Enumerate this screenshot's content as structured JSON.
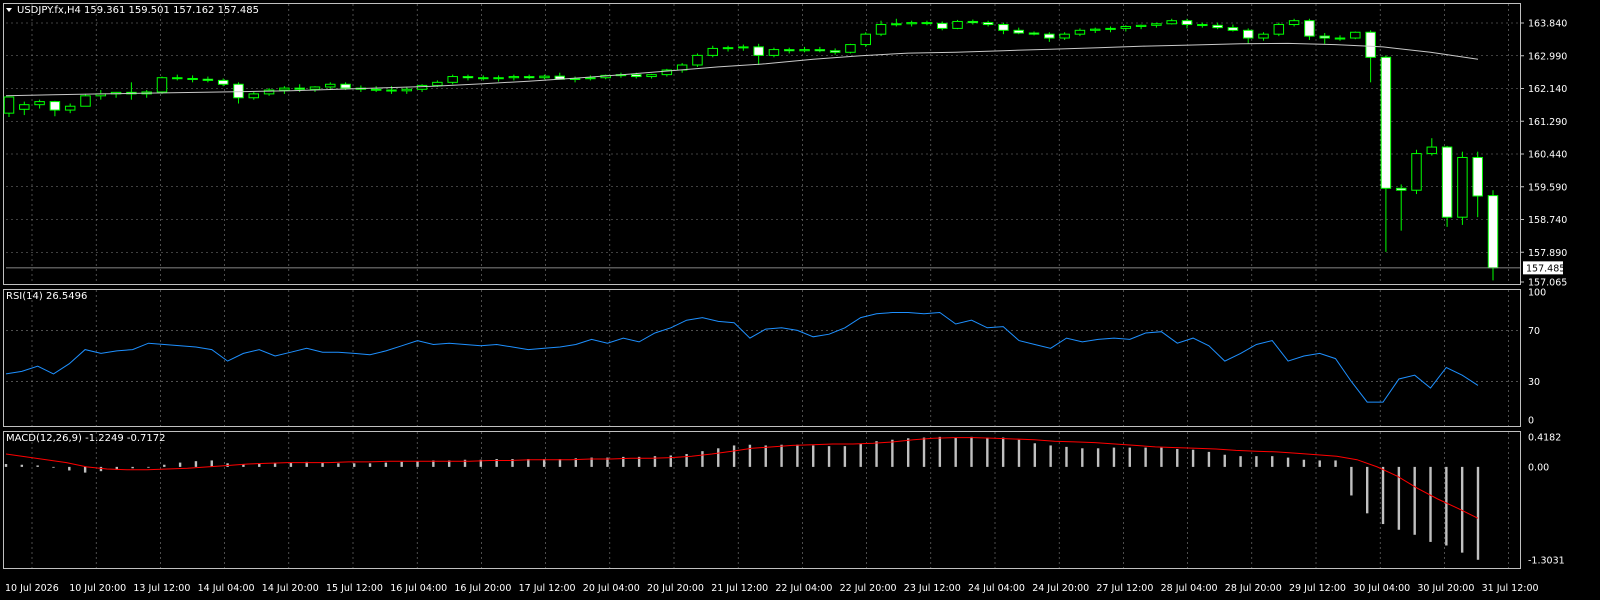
{
  "window": {
    "symbol_header": "USDJPY.fx,H4",
    "ohlc_header": "159.361 159.501 157.162 157.485"
  },
  "colors": {
    "background": "#000000",
    "grid": "#808080",
    "bull_body": "#000000",
    "bear_body": "#ffffff",
    "candle_wick": "#00ff00",
    "ma_line": "#c8c8c8",
    "rsi_line": "#1e90ff",
    "macd_hist": "#c0c0c0",
    "macd_signal": "#ff0000",
    "text": "#ffffff"
  },
  "chart_data": [
    {
      "type": "candlestick",
      "panel": "price",
      "title": "USDJPY.fx,H4",
      "ylim": [
        157.065,
        164.6
      ],
      "y_ticks": [
        "163.840",
        "162.990",
        "162.140",
        "161.290",
        "160.440",
        "159.590",
        "158.740",
        "157.890",
        "157.065"
      ],
      "last_price_label": "157.485",
      "last_price": 157.485,
      "x_tick_labels": [
        "10 Jul 2026",
        "10 Jul 20:00",
        "13 Jul 12:00",
        "14 Jul 04:00",
        "14 Jul 20:00",
        "15 Jul 12:00",
        "16 Jul 04:00",
        "16 Jul 20:00",
        "17 Jul 12:00",
        "20 Jul 04:00",
        "20 Jul 20:00",
        "21 Jul 12:00",
        "22 Jul 04:00",
        "22 Jul 20:00",
        "23 Jul 12:00",
        "24 Jul 04:00",
        "24 Jul 20:00",
        "27 Jul 12:00",
        "28 Jul 04:00",
        "28 Jul 20:00",
        "29 Jul 12:00",
        "30 Jul 04:00",
        "30 Jul 20:00",
        "31 Jul 12:00"
      ],
      "ohlc": [
        [
          161.5,
          161.7,
          161.4,
          161.92
        ],
        [
          161.6,
          161.8,
          161.45,
          161.72
        ],
        [
          161.72,
          161.85,
          161.62,
          161.8
        ],
        [
          161.8,
          161.82,
          161.42,
          161.58
        ],
        [
          161.58,
          161.75,
          161.5,
          161.68
        ],
        [
          161.68,
          162.0,
          161.68,
          161.95
        ],
        [
          161.95,
          162.1,
          161.85,
          162.0
        ],
        [
          162.0,
          162.05,
          161.9,
          162.04
        ],
        [
          162.04,
          162.3,
          161.85,
          162.0
        ],
        [
          162.0,
          162.1,
          161.9,
          162.05
        ],
        [
          162.05,
          162.45,
          162.0,
          162.42
        ],
        [
          162.42,
          162.5,
          162.35,
          162.4
        ],
        [
          162.4,
          162.48,
          162.3,
          162.38
        ],
        [
          162.38,
          162.45,
          162.3,
          162.35
        ],
        [
          162.35,
          162.4,
          162.2,
          162.25
        ],
        [
          162.25,
          162.3,
          161.75,
          161.9
        ],
        [
          161.9,
          162.05,
          161.85,
          162.0
        ],
        [
          162.0,
          162.15,
          161.95,
          162.1
        ],
        [
          162.1,
          162.2,
          162.0,
          162.15
        ],
        [
          162.15,
          162.25,
          162.05,
          162.12
        ],
        [
          162.12,
          162.2,
          162.05,
          162.18
        ],
        [
          162.18,
          162.3,
          162.1,
          162.25
        ],
        [
          162.25,
          162.3,
          162.1,
          162.15
        ],
        [
          162.15,
          162.22,
          162.05,
          162.12
        ],
        [
          162.12,
          162.2,
          162.05,
          162.1
        ],
        [
          162.1,
          162.2,
          162.0,
          162.08
        ],
        [
          162.08,
          162.18,
          162.0,
          162.12
        ],
        [
          162.12,
          162.25,
          162.05,
          162.22
        ],
        [
          162.22,
          162.35,
          162.18,
          162.3
        ],
        [
          162.3,
          162.5,
          162.25,
          162.45
        ],
        [
          162.45,
          162.5,
          162.35,
          162.42
        ],
        [
          162.42,
          162.48,
          162.35,
          162.4
        ],
        [
          162.4,
          162.48,
          162.32,
          162.42
        ],
        [
          162.42,
          162.5,
          162.35,
          162.45
        ],
        [
          162.45,
          162.5,
          162.38,
          162.42
        ],
        [
          162.42,
          162.5,
          162.38,
          162.46
        ],
        [
          162.46,
          162.55,
          162.4,
          162.38
        ],
        [
          162.38,
          162.45,
          162.3,
          162.4
        ],
        [
          162.4,
          162.48,
          162.35,
          162.42
        ],
        [
          162.42,
          162.5,
          162.38,
          162.48
        ],
        [
          162.48,
          162.55,
          162.42,
          162.5
        ],
        [
          162.5,
          162.55,
          162.4,
          162.45
        ],
        [
          162.45,
          162.52,
          162.4,
          162.5
        ],
        [
          162.5,
          162.65,
          162.45,
          162.62
        ],
        [
          162.62,
          162.8,
          162.55,
          162.75
        ],
        [
          162.75,
          163.05,
          162.7,
          163.0
        ],
        [
          163.0,
          163.25,
          162.95,
          163.18
        ],
        [
          163.18,
          163.25,
          163.1,
          163.2
        ],
        [
          163.2,
          163.28,
          163.12,
          163.22
        ],
        [
          163.22,
          163.3,
          162.75,
          163.0
        ],
        [
          163.0,
          163.2,
          162.95,
          163.15
        ],
        [
          163.15,
          163.2,
          163.05,
          163.12
        ],
        [
          163.12,
          163.22,
          163.08,
          163.15
        ],
        [
          163.15,
          163.22,
          163.08,
          163.12
        ],
        [
          163.12,
          163.18,
          163.02,
          163.08
        ],
        [
          163.08,
          163.3,
          163.05,
          163.28
        ],
        [
          163.28,
          163.6,
          163.22,
          163.55
        ],
        [
          163.55,
          163.9,
          163.5,
          163.8
        ],
        [
          163.8,
          163.95,
          163.75,
          163.82
        ],
        [
          163.82,
          163.9,
          163.75,
          163.85
        ],
        [
          163.85,
          163.9,
          163.78,
          163.83
        ],
        [
          163.83,
          163.88,
          163.65,
          163.7
        ],
        [
          163.7,
          163.92,
          163.68,
          163.88
        ],
        [
          163.88,
          163.93,
          163.8,
          163.85
        ],
        [
          163.85,
          163.9,
          163.75,
          163.8
        ],
        [
          163.8,
          163.85,
          163.55,
          163.65
        ],
        [
          163.65,
          163.72,
          163.55,
          163.58
        ],
        [
          163.58,
          163.62,
          163.52,
          163.55
        ],
        [
          163.55,
          163.6,
          163.35,
          163.45
        ],
        [
          163.45,
          163.6,
          163.4,
          163.55
        ],
        [
          163.55,
          163.7,
          163.5,
          163.65
        ],
        [
          163.65,
          163.72,
          163.58,
          163.68
        ],
        [
          163.68,
          163.75,
          163.6,
          163.7
        ],
        [
          163.7,
          163.78,
          163.62,
          163.75
        ],
        [
          163.75,
          163.8,
          163.68,
          163.78
        ],
        [
          163.78,
          163.85,
          163.72,
          163.82
        ],
        [
          163.82,
          163.95,
          163.8,
          163.9
        ],
        [
          163.9,
          163.95,
          163.7,
          163.8
        ],
        [
          163.8,
          163.85,
          163.72,
          163.78
        ],
        [
          163.78,
          163.85,
          163.68,
          163.72
        ],
        [
          163.72,
          163.8,
          163.62,
          163.65
        ],
        [
          163.65,
          163.7,
          163.3,
          163.45
        ],
        [
          163.45,
          163.6,
          163.38,
          163.55
        ],
        [
          163.55,
          163.85,
          163.5,
          163.8
        ],
        [
          163.8,
          163.95,
          163.75,
          163.9
        ],
        [
          163.9,
          163.95,
          163.4,
          163.5
        ],
        [
          163.5,
          163.58,
          163.3,
          163.45
        ],
        [
          163.45,
          163.52,
          163.38,
          163.45
        ],
        [
          163.45,
          163.62,
          163.42,
          163.6
        ],
        [
          163.6,
          163.65,
          162.3,
          162.95
        ],
        [
          162.95,
          163.0,
          157.9,
          159.55
        ],
        [
          159.55,
          159.65,
          158.45,
          159.5
        ],
        [
          159.5,
          160.55,
          159.4,
          160.45
        ],
        [
          160.45,
          160.85,
          160.4,
          160.62
        ],
        [
          160.62,
          160.65,
          158.55,
          158.8
        ],
        [
          158.8,
          160.5,
          158.6,
          160.35
        ],
        [
          160.35,
          160.5,
          158.8,
          159.35
        ],
        [
          159.36,
          159.5,
          157.16,
          157.49
        ]
      ],
      "ma": [
        161.95,
        161.98,
        162.0,
        162.02,
        162.04,
        162.06,
        162.08,
        162.12,
        162.16,
        162.2,
        162.26,
        162.33,
        162.41,
        162.5,
        162.6,
        162.7,
        162.78,
        162.9,
        162.99,
        163.06,
        163.08,
        163.12,
        163.16,
        163.2,
        163.24,
        163.27,
        163.3,
        163.31,
        163.28,
        163.22,
        163.08,
        162.9
      ]
    },
    {
      "type": "line",
      "panel": "RSI",
      "title": "RSI(14) 26.5496",
      "ylim": [
        0,
        100
      ],
      "y_ticks": [
        "100",
        "70",
        "30",
        "0"
      ],
      "levels": [
        70,
        30
      ],
      "values": [
        36,
        38,
        42,
        36,
        44,
        55,
        52,
        54,
        55,
        60,
        59,
        58,
        57,
        55,
        46,
        52,
        55,
        50,
        53,
        56,
        53,
        53,
        52,
        51,
        54,
        58,
        62,
        59,
        60,
        59,
        58,
        59,
        57,
        55,
        56,
        57,
        59,
        63,
        60,
        64,
        61,
        68,
        72,
        78,
        80,
        77,
        76,
        64,
        71,
        72,
        70,
        65,
        67,
        72,
        80,
        83,
        84,
        84,
        83,
        84,
        75,
        78,
        72,
        73,
        62,
        59,
        56,
        64,
        61,
        63,
        64,
        63,
        68,
        69,
        60,
        64,
        58,
        46,
        52,
        59,
        62,
        46,
        50,
        52,
        48,
        30,
        14,
        14,
        32,
        35,
        25,
        41,
        35,
        27
      ],
      "series": [
        {
          "name": "RSI(14)",
          "last": 26.5496
        }
      ]
    },
    {
      "type": "bar",
      "panel": "MACD",
      "title": "MACD(12,26,9) -1.2249 -0.7172",
      "ylim": [
        -1.3031,
        0.4182
      ],
      "y_ticks": [
        "0.4182",
        "0.00",
        "-1.3031"
      ],
      "histogram": [
        0.04,
        0.03,
        0.02,
        0.0,
        -0.05,
        -0.08,
        -0.06,
        -0.04,
        -0.02,
        0.0,
        0.03,
        0.06,
        0.08,
        0.09,
        0.05,
        0.04,
        0.05,
        0.06,
        0.06,
        0.07,
        0.06,
        0.05,
        0.05,
        0.05,
        0.06,
        0.07,
        0.08,
        0.09,
        0.09,
        0.1,
        0.1,
        0.11,
        0.11,
        0.11,
        0.11,
        0.11,
        0.12,
        0.13,
        0.13,
        0.14,
        0.14,
        0.15,
        0.16,
        0.18,
        0.22,
        0.26,
        0.3,
        0.31,
        0.3,
        0.31,
        0.31,
        0.3,
        0.29,
        0.29,
        0.32,
        0.36,
        0.38,
        0.4,
        0.41,
        0.42,
        0.41,
        0.42,
        0.41,
        0.41,
        0.38,
        0.33,
        0.3,
        0.28,
        0.26,
        0.26,
        0.27,
        0.27,
        0.27,
        0.27,
        0.25,
        0.24,
        0.21,
        0.17,
        0.15,
        0.15,
        0.15,
        0.13,
        0.1,
        0.09,
        0.09,
        -0.4,
        -0.65,
        -0.8,
        -0.88,
        -0.95,
        -1.05,
        -1.1,
        -1.2,
        -1.3
      ],
      "signal": [
        0.18,
        0.14,
        0.1,
        0.06,
        0.0,
        -0.03,
        -0.04,
        -0.04,
        -0.03,
        -0.02,
        0.0,
        0.02,
        0.04,
        0.05,
        0.06,
        0.06,
        0.06,
        0.07,
        0.07,
        0.08,
        0.08,
        0.08,
        0.08,
        0.08,
        0.09,
        0.09,
        0.1,
        0.1,
        0.1,
        0.11,
        0.11,
        0.12,
        0.12,
        0.13,
        0.15,
        0.18,
        0.22,
        0.26,
        0.28,
        0.3,
        0.31,
        0.32,
        0.32,
        0.33,
        0.35,
        0.38,
        0.4,
        0.41,
        0.41,
        0.4,
        0.39,
        0.38,
        0.36,
        0.35,
        0.34,
        0.32,
        0.3,
        0.28,
        0.27,
        0.26,
        0.25,
        0.23,
        0.22,
        0.21,
        0.19,
        0.17,
        0.15,
        0.1,
        0.0,
        -0.13,
        -0.3,
        -0.45,
        -0.58,
        -0.72
      ],
      "series": [
        {
          "name": "MACD(12,26,9)",
          "last": -1.2249
        },
        {
          "name": "signal",
          "last": -0.7172
        }
      ]
    }
  ]
}
